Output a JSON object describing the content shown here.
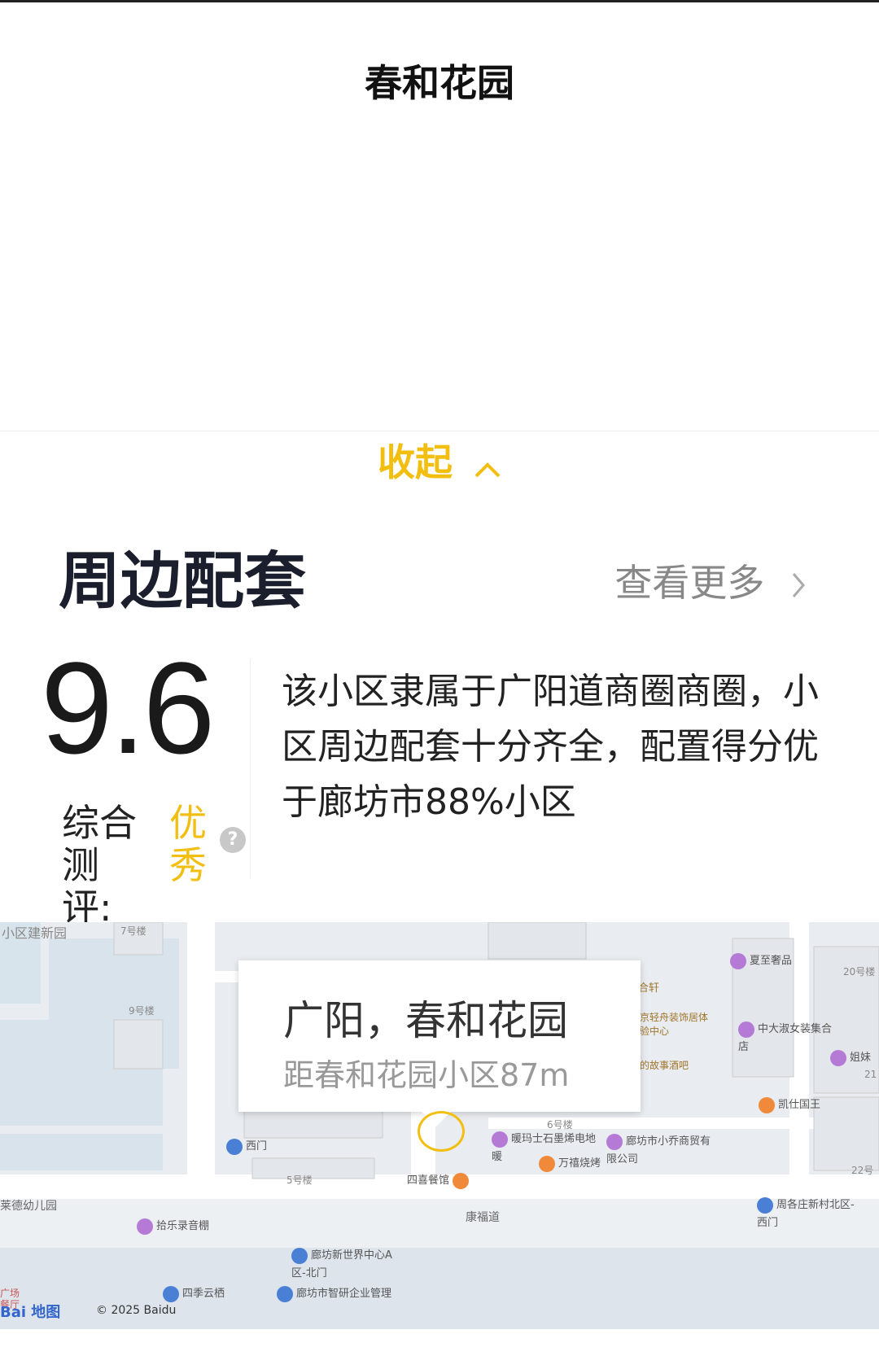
{
  "header": {
    "title": "春和花园"
  },
  "collapse": {
    "label": "收起"
  },
  "surroundings": {
    "section_title": "周边配套",
    "more_label": "查看更多",
    "score": "9.6",
    "score_label_line1": "综合",
    "score_label_line2": "测评:",
    "grade_line1": "优",
    "grade_line2": "秀",
    "help_glyph": "?",
    "description": "该小区隶属于广阳道商圈商圈，小区周边配套十分齐全，配置得分优于廊坊市88%小区"
  },
  "map": {
    "popup_title": "广阳，春和花园",
    "popup_subtitle": "距春和花园小区87m",
    "pois": [
      {
        "label": "夏至奢品",
        "color": "#b57ad6"
      },
      {
        "label": "中大淑女装集合店",
        "color": "#b57ad6"
      },
      {
        "label": "姐妹",
        "color": "#b57ad6"
      },
      {
        "label": "凯仕国王",
        "color": "#f08a3a"
      },
      {
        "label": "暖玛士石墨烯电地暖",
        "color": "#b57ad6"
      },
      {
        "label": "廊坊市小乔商贸有限公司",
        "color": "#b57ad6"
      },
      {
        "label": "万禧烧烤",
        "color": "#f08a3a"
      },
      {
        "label": "四喜餐馆",
        "color": "#f08a3a"
      },
      {
        "label": "西门",
        "color": "#4a7fd6"
      },
      {
        "label": "拾乐录音棚",
        "color": "#b57ad6"
      },
      {
        "label": "廊坊新世界中心A区-北门",
        "color": "#4a7fd6"
      },
      {
        "label": "周各庄新村北区-西门",
        "color": "#4a7fd6"
      },
      {
        "label": "四季云栖",
        "color": "#4a7fd6"
      },
      {
        "label": "廊坊市智研企业管理",
        "color": "#4a7fd6"
      }
    ],
    "labels": {
      "jianxinyuan": "小区建新园",
      "b7": "7号楼",
      "b9": "9号楼",
      "b6": "6号楼",
      "b5": "5号楼",
      "b20": "20号楼",
      "b21": "21",
      "b22": "22号",
      "kindergarten": "莱德幼儿园",
      "road": "康福道",
      "he": "合轩",
      "jingqing": "京轻舟装饰居体验中心",
      "gushi": "的故事酒吧",
      "plaza": "广场",
      "canting": "餐厅"
    },
    "baidu_logo": "Bai 地图",
    "copyright": "© 2025 Baidu"
  }
}
